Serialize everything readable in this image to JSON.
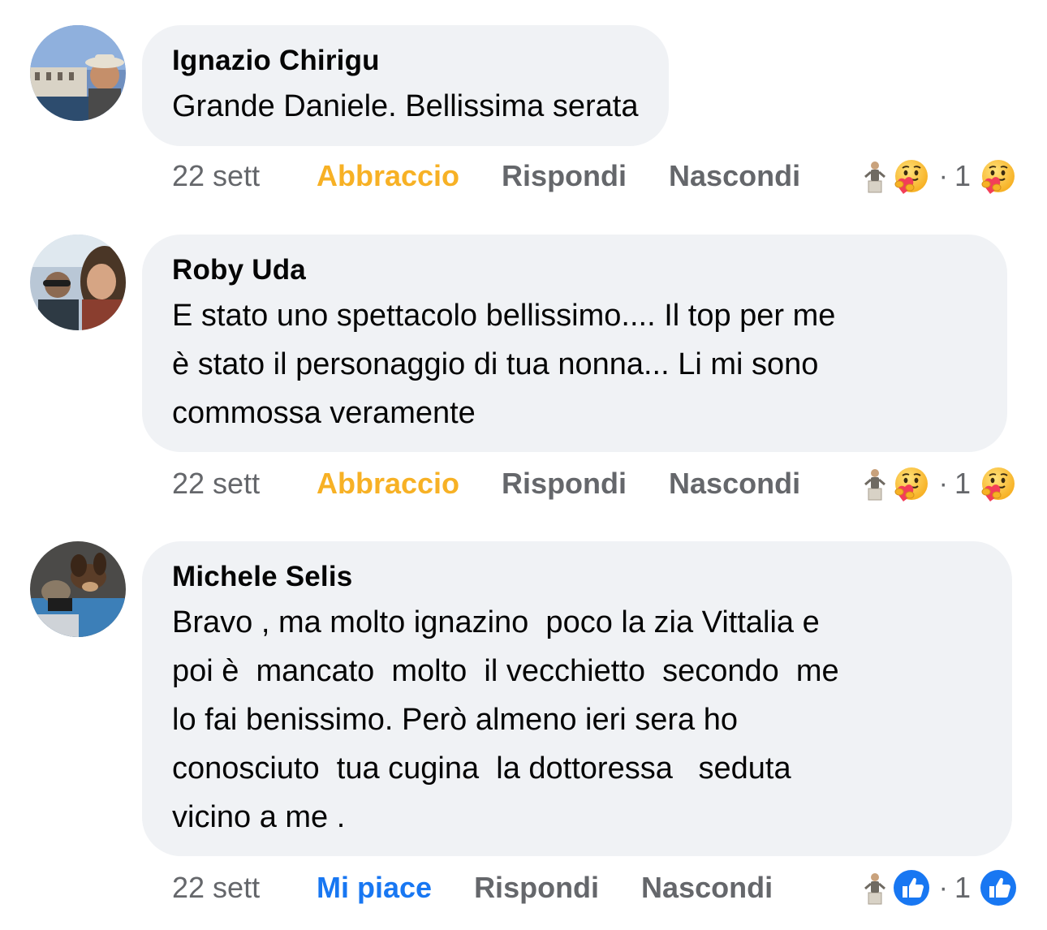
{
  "comments": [
    {
      "author": "Ignazio Chirigu",
      "text": "Grande Daniele. Bellissima serata",
      "time": "22 sett",
      "reaction_action": "Abbraccio",
      "reply": "Rispondi",
      "hide": "Nascondi",
      "reaction_count": "1",
      "reaction_icon": "care-hug-emoji",
      "accent": "#f7b125"
    },
    {
      "author": "Roby Uda",
      "text": "E stato uno spettacolo bellissimo.... Il top per me\nè stato il personaggio di tua nonna... Li mi sono\ncommossa veramente",
      "time": "22 sett",
      "reaction_action": "Abbraccio",
      "reply": "Rispondi",
      "hide": "Nascondi",
      "reaction_count": "1",
      "reaction_icon": "care-hug-emoji",
      "accent": "#f7b125"
    },
    {
      "author": "Michele Selis",
      "text": "Bravo , ma molto ignazino  poco la zia Vittalia e\npoi è  mancato  molto  il vecchietto  secondo  me\nlo fai benissimo. Però almeno ieri sera ho\nconosciuto  tua cugina  la dottoressa   seduta\nvicino a me .",
      "time": "22 sett",
      "reaction_action": "Mi piace",
      "reply": "Rispondi",
      "hide": "Nascondi",
      "reaction_count": "1",
      "reaction_icon": "like-thumb-icon",
      "accent": "#1877f2"
    }
  ],
  "separator_dot": "·"
}
